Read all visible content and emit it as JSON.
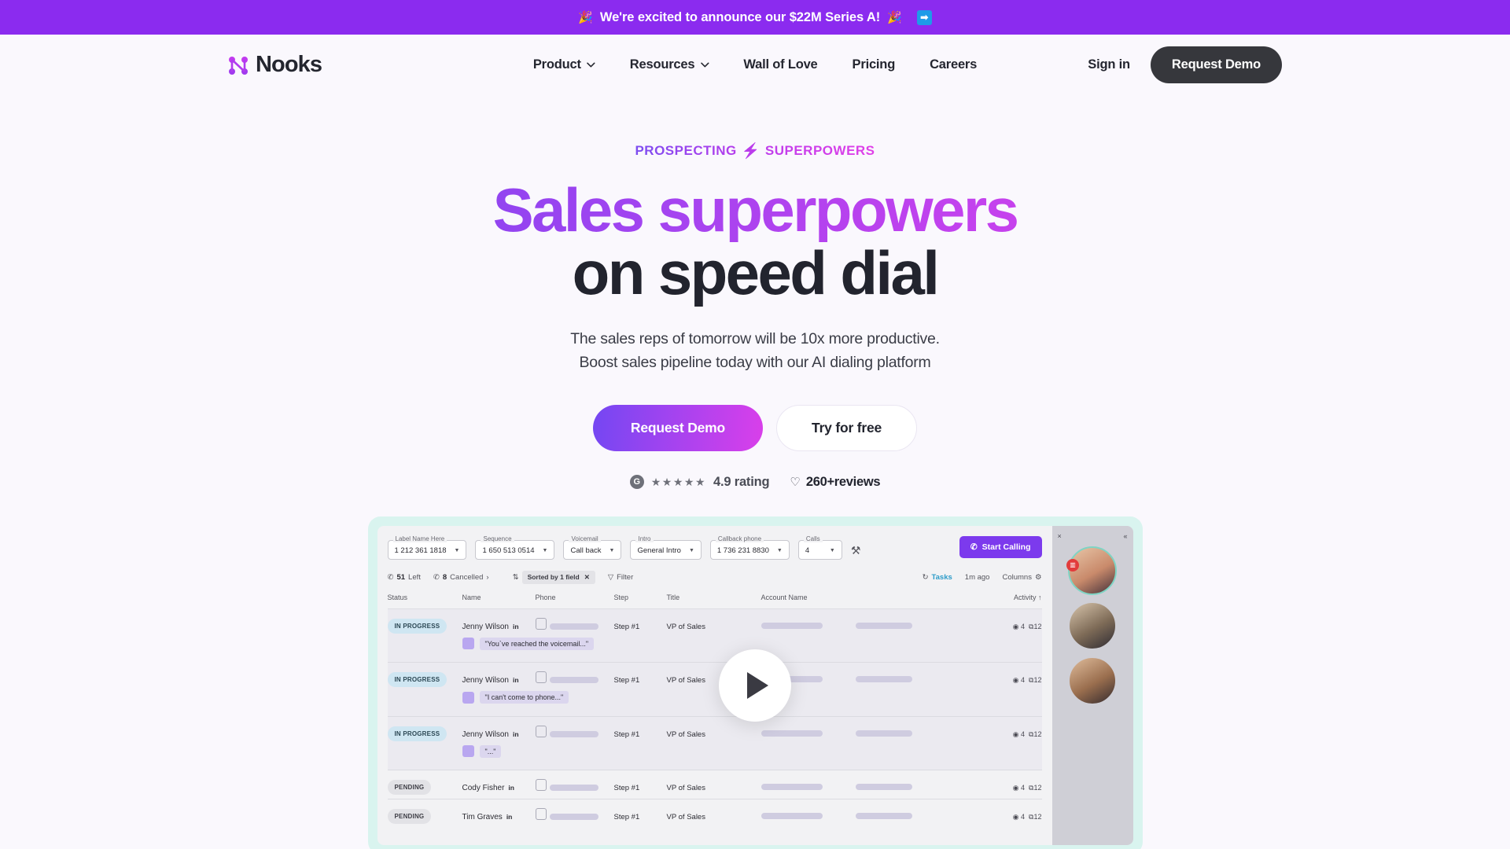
{
  "banner": {
    "emoji_left": "🎉",
    "text": "We're excited to announce our $22M Series A!",
    "emoji_right": "🎉",
    "arrow": "➡",
    "bg_color": "#8B2BEF"
  },
  "header": {
    "logo_text": "Nooks",
    "nav": [
      {
        "label": "Product",
        "has_dropdown": true
      },
      {
        "label": "Resources",
        "has_dropdown": true
      },
      {
        "label": "Wall of Love",
        "has_dropdown": false
      },
      {
        "label": "Pricing",
        "has_dropdown": false
      },
      {
        "label": "Careers",
        "has_dropdown": false
      }
    ],
    "signin_label": "Sign in",
    "demo_label": "Request Demo"
  },
  "hero": {
    "eyebrow_left": "PROSPECTING",
    "eyebrow_bolt": "⚡",
    "eyebrow_right": "SUPERPOWERS",
    "headline_gradient": "Sales superpowers",
    "headline_dark": "on speed dial",
    "sub_line1": "The sales reps of tomorrow will be 10x more productive.",
    "sub_line2": "Boost sales pipeline today with our AI dialing platform",
    "cta_primary": "Request Demo",
    "cta_secondary": "Try for free",
    "gradient_start": "#6A4BF4",
    "gradient_end": "#E93FE8"
  },
  "rating": {
    "g2_letter": "G",
    "stars": "★★★★★",
    "score_label": "4.9 rating",
    "heart": "♡",
    "reviews_label": "260+reviews"
  },
  "app": {
    "filters": [
      {
        "label": "Label Name Here",
        "value": "1 212 361 1818"
      },
      {
        "label": "Sequence",
        "value": "1 650 513 0514"
      },
      {
        "label": "Voicemail",
        "value": "Call back"
      },
      {
        "label": "Intro",
        "value": "General Intro"
      },
      {
        "label": "Callback phone",
        "value": "1 736 231 8830"
      },
      {
        "label": "Calls",
        "value": "4"
      }
    ],
    "start_calling": "Start Calling",
    "toolbar": {
      "left_count": "51",
      "left_label": "Left",
      "cancelled_count": "8",
      "cancelled_label": "Cancelled",
      "sort_chip": "Sorted by 1 field",
      "filter_label": "Filter",
      "tasks_label": "Tasks",
      "updated_label": "1m ago",
      "columns_label": "Columns"
    },
    "columns": [
      "Status",
      "Name",
      "Phone",
      "Step",
      "Title",
      "Account Name",
      "",
      "Activity ↑"
    ],
    "rows": [
      {
        "status": "IN PROGRESS",
        "status_type": "prog",
        "name": "Jenny Wilson",
        "linkedin": "in",
        "step": "Step #1",
        "title": "VP of Sales",
        "activity_views": "4",
        "activity_links": "12",
        "quote": "\"You`ve reached  the voicemail...\""
      },
      {
        "status": "IN PROGRESS",
        "status_type": "prog",
        "name": "Jenny Wilson",
        "linkedin": "in",
        "step": "Step #1",
        "title": "VP of Sales",
        "activity_views": "4",
        "activity_links": "12",
        "quote": "\"I can't come to phone...\""
      },
      {
        "status": "IN PROGRESS",
        "status_type": "prog",
        "name": "Jenny Wilson",
        "linkedin": "in",
        "step": "Step #1",
        "title": "VP of Sales",
        "activity_views": "4",
        "activity_links": "12",
        "quote": "\"...\""
      },
      {
        "status": "PENDING",
        "status_type": "pend",
        "name": "Cody Fisher",
        "linkedin": "in",
        "step": "Step #1",
        "title": "VP of Sales",
        "activity_views": "4",
        "activity_links": "12",
        "quote": ""
      },
      {
        "status": "PENDING",
        "status_type": "pend",
        "name": "Tim Graves",
        "linkedin": "in",
        "step": "Step #1",
        "title": "VP of Sales",
        "activity_views": "4",
        "activity_links": "12",
        "quote": ""
      }
    ],
    "sidebar": {
      "close": "×",
      "collapse": "«",
      "mute_badge": "▥"
    },
    "play_button": "play"
  }
}
